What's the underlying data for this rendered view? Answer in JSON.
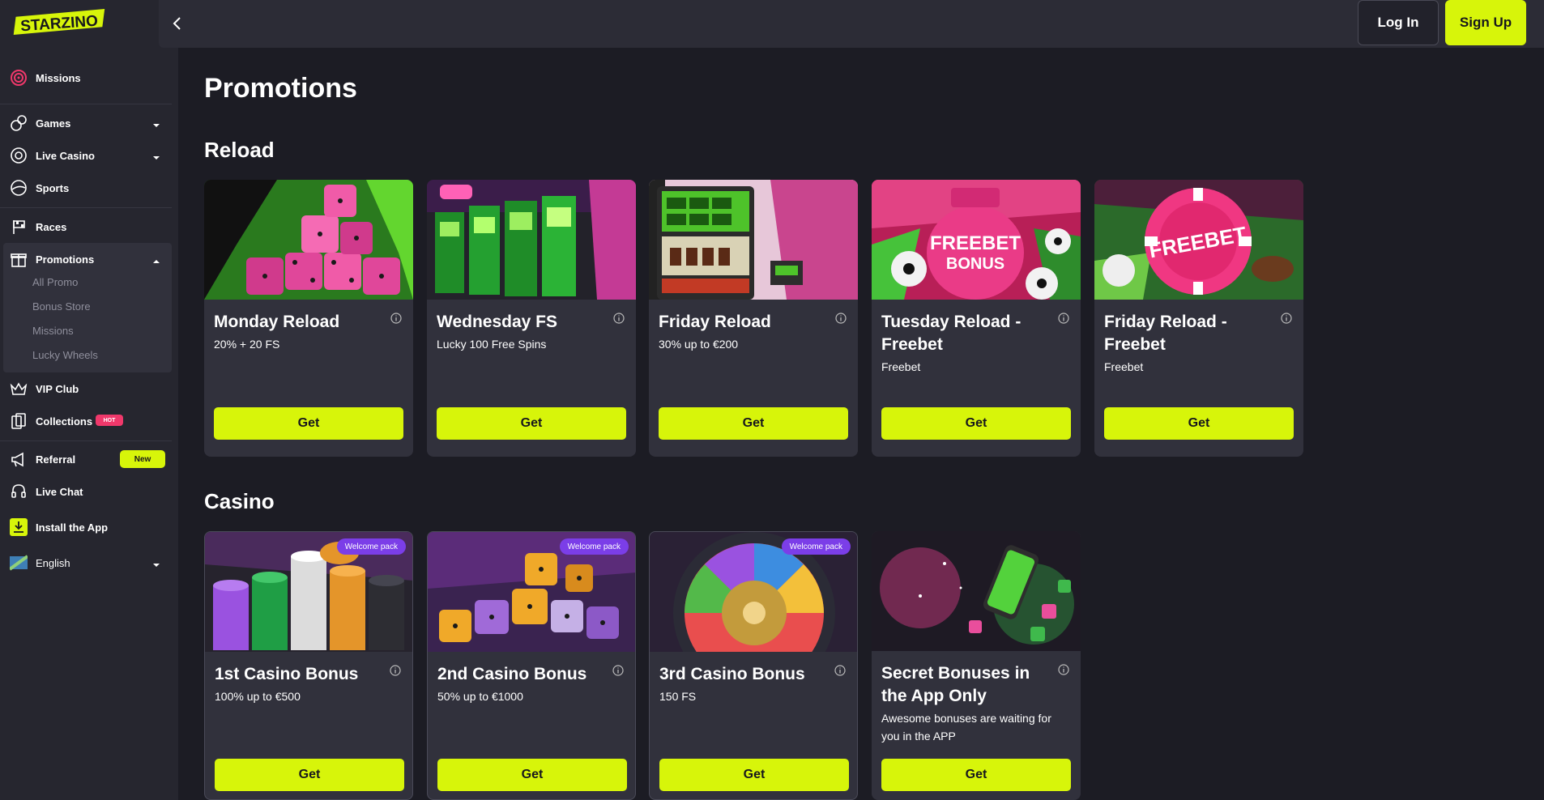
{
  "brand": {
    "name": "STARZINO",
    "accent": "#d7f50a",
    "background": "#1c1c24",
    "sidebar_bg": "#26262f",
    "card_bg": "#31313c"
  },
  "header": {
    "login_label": "Log In",
    "signup_label": "Sign Up"
  },
  "sidebar": {
    "missions": "Missions",
    "games": "Games",
    "live_casino": "Live Casino",
    "sports": "Sports",
    "races": "Races",
    "promotions": "Promotions",
    "promo_sub": [
      "All Promo",
      "Bonus Store",
      "Missions",
      "Lucky Wheels"
    ],
    "vip_club": "VIP Club",
    "collections": "Collections",
    "hot_badge": "HOT",
    "referral": "Referral",
    "new_badge": "New",
    "live_chat": "Live Chat",
    "install_app": "Install the App",
    "language": "English"
  },
  "page": {
    "title": "Promotions"
  },
  "sections": {
    "reload": {
      "title": "Reload",
      "cards": [
        {
          "title": "Monday Reload",
          "subtitle": "20% + 20 FS",
          "button": "Get"
        },
        {
          "title": "Wednesday FS",
          "subtitle": "Lucky 100 Free Spins",
          "button": "Get"
        },
        {
          "title": "Friday Reload",
          "subtitle": "30% up to €200",
          "button": "Get"
        },
        {
          "title": "Tuesday Reload - Freebet",
          "subtitle": "Freebet",
          "button": "Get",
          "image_text": [
            "FREEBET",
            "BONUS"
          ]
        },
        {
          "title": "Friday Reload - Freebet",
          "subtitle": "Freebet",
          "button": "Get",
          "image_text": [
            "FREEBET"
          ]
        }
      ]
    },
    "casino": {
      "title": "Casino",
      "cards": [
        {
          "title": "1st Casino Bonus",
          "subtitle": "100% up to €500",
          "button": "Get",
          "badge": "Welcome pack"
        },
        {
          "title": "2nd Casino Bonus",
          "subtitle": "50% up to €1000",
          "button": "Get",
          "badge": "Welcome pack"
        },
        {
          "title": "3rd Casino Bonus",
          "subtitle": "150 FS",
          "button": "Get",
          "badge": "Welcome pack"
        },
        {
          "title": "Secret Bonuses in the App Only",
          "subtitle": "Awesome bonuses are waiting for you in the APP",
          "button": "Get"
        }
      ]
    }
  }
}
